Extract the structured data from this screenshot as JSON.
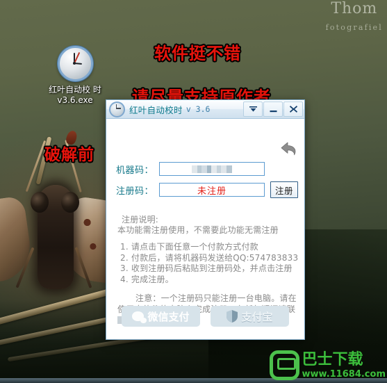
{
  "desktop": {
    "icon": {
      "name": "clock-icon",
      "label": "红叶自动校\n时v3.6.exe"
    },
    "watermark": {
      "name": "Thom",
      "subtitle": "fotografiel"
    },
    "annotations": [
      {
        "text": "软件挺不错",
        "color": "#e8140c"
      },
      {
        "text": "请尽量支持原作者",
        "color": "#e8140c"
      },
      {
        "text": "破解前",
        "color": "#e8140c"
      }
    ]
  },
  "dialog": {
    "icon": "clock-icon",
    "title": "红叶自动校时",
    "version": "v 3.6",
    "titlebar_buttons": [
      {
        "name": "collapse-button",
        "glyph": "chevron-down-icon"
      },
      {
        "name": "minimize-button",
        "glyph": "minimize-icon"
      },
      {
        "name": "close-button",
        "glyph": "close-icon"
      }
    ],
    "undo_button": "undo-icon",
    "fields": [
      {
        "label": "机器码：",
        "value": "",
        "masked": true,
        "placeholder": ""
      },
      {
        "label": "注册码：",
        "value": "未注册",
        "masked": false,
        "placeholder": ""
      }
    ],
    "register_button": "注册",
    "notes": {
      "heading": "注册说明:",
      "subheading": "本功能需注册使用，不需要此功能无需注册",
      "steps": [
        "1. 请点击下面任意一个付款方式付款",
        "2. 付款后，请将机器码发送给QQ:574783833",
        "3. 收到注册码后粘贴到注册码处，并点击注册",
        "4. 完成注册。"
      ],
      "warning_line1": "注意：一个注册码只能注册一台电脑。请在",
      "warning_line2": "使用本软件的电脑上完成注册，有任何疑问请联"
    },
    "payment_buttons": [
      {
        "name": "wechat-pay-button",
        "label": "微信支付",
        "icon": "wechat-icon"
      },
      {
        "name": "alipay-button",
        "label": "支付宝",
        "icon": "alipay-shield-icon"
      }
    ]
  },
  "site_logo": {
    "name": "巴士下载",
    "url": "www.11684.com",
    "color": "#3cbf3c"
  }
}
